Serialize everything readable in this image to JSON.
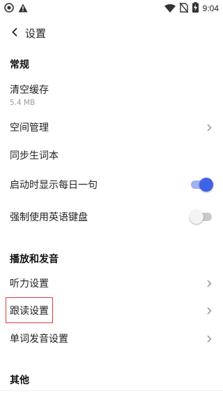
{
  "status_bar": {
    "time": "9:04",
    "icons_left": [
      "circle-icon",
      "warning-icon"
    ],
    "icons_right": [
      "wifi-icon",
      "no-sim-icon",
      "battery-charging-icon"
    ]
  },
  "header": {
    "title": "设置",
    "back_icon": "chevron-left-icon"
  },
  "sections": {
    "general": "常规",
    "playback": "播放和发音",
    "other": "其他"
  },
  "rows": {
    "clear_cache": {
      "label": "清空缓存",
      "sub": "5.4 MB"
    },
    "space_mgmt": {
      "label": "空间管理"
    },
    "sync_words": {
      "label": "同步生词本"
    },
    "daily_sentence": {
      "label": "启动时显示每日一句",
      "toggle": true
    },
    "force_english_kb": {
      "label": "强制使用英语键盘",
      "toggle": false
    },
    "listening": {
      "label": "听力设置"
    },
    "follow_read": {
      "label": "跟读设置"
    },
    "word_pronounce": {
      "label": "单词发音设置"
    }
  },
  "colors": {
    "accent": "#3f63e6",
    "highlight_box": "#e23a3a"
  }
}
